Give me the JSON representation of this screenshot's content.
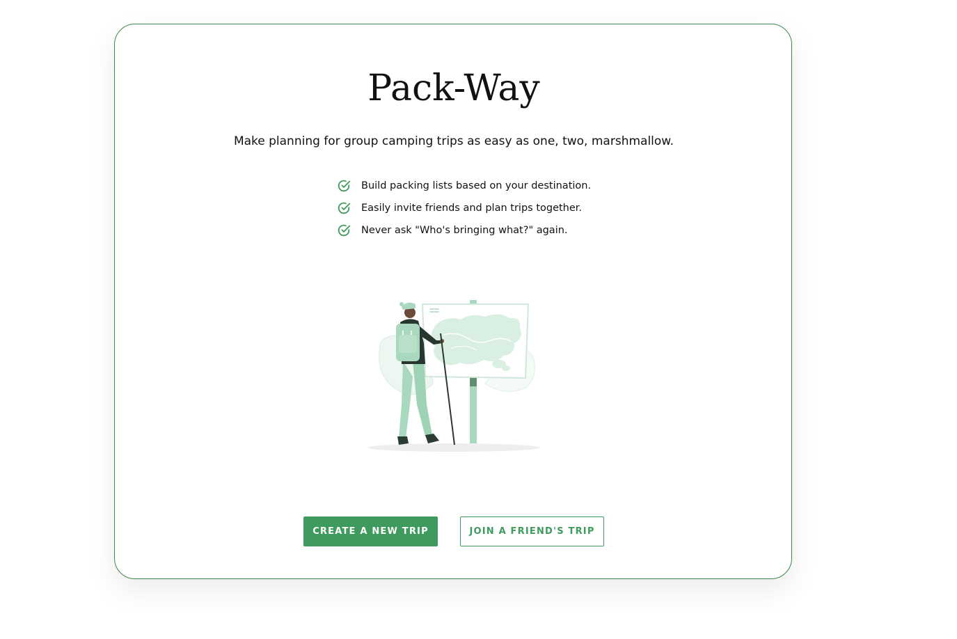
{
  "app": {
    "title": "Pack-Way",
    "tagline": "Make planning for group camping trips as easy as one, two, marshmallow."
  },
  "features": [
    {
      "icon": "check-circle-icon",
      "text": "Build packing lists based on your destination."
    },
    {
      "icon": "check-circle-icon",
      "text": "Easily invite friends and plan trips together."
    },
    {
      "icon": "check-circle-icon",
      "text": "Never ask \"Who's bringing what?\" again."
    }
  ],
  "illustration": {
    "icon": "hiker-with-map-illustration"
  },
  "actions": {
    "create_label": "CREATE A NEW TRIP",
    "join_label": "JOIN A FRIEND'S TRIP"
  },
  "colors": {
    "accent": "#3f9a5d",
    "card_border": "#3a8a4e",
    "illustration_green": "#a8d8bd"
  }
}
